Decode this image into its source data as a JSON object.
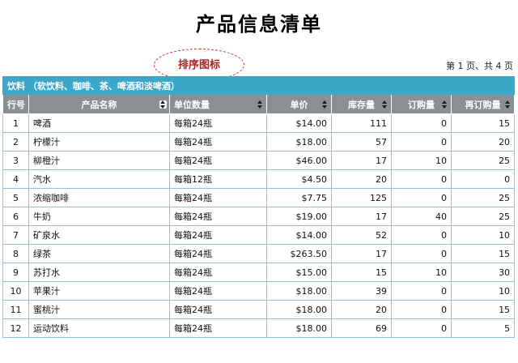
{
  "title": "产品信息清单",
  "callout_label": "排序图标",
  "page_info": "第 1 页、共 4 页",
  "group_header": "饮料  （软饮料、咖啡、茶、啤酒和淡啤酒）",
  "columns": [
    "行号",
    "产品名称",
    "单位数量",
    "单价",
    "库存量",
    "订购量",
    "再订购量"
  ],
  "rows": [
    {
      "no": "1",
      "name": "啤酒",
      "unit": "每箱24瓶",
      "price": "$14.00",
      "stock": "111",
      "ordered": "0",
      "reorder": "15"
    },
    {
      "no": "2",
      "name": "柠檬汁",
      "unit": "每箱24瓶",
      "price": "$18.00",
      "stock": "57",
      "ordered": "0",
      "reorder": "20"
    },
    {
      "no": "3",
      "name": "柳橙汁",
      "unit": "每箱24瓶",
      "price": "$46.00",
      "stock": "17",
      "ordered": "10",
      "reorder": "25"
    },
    {
      "no": "4",
      "name": "汽水",
      "unit": "每箱12瓶",
      "price": "$4.50",
      "stock": "20",
      "ordered": "0",
      "reorder": "0"
    },
    {
      "no": "5",
      "name": "浓缩咖啡",
      "unit": "每箱24瓶",
      "price": "$7.75",
      "stock": "125",
      "ordered": "0",
      "reorder": "25"
    },
    {
      "no": "6",
      "name": "牛奶",
      "unit": "每箱24瓶",
      "price": "$19.00",
      "stock": "17",
      "ordered": "40",
      "reorder": "25"
    },
    {
      "no": "7",
      "name": "矿泉水",
      "unit": "每箱24瓶",
      "price": "$14.00",
      "stock": "52",
      "ordered": "0",
      "reorder": "10"
    },
    {
      "no": "8",
      "name": "绿茶",
      "unit": "每箱24瓶",
      "price": "$263.50",
      "stock": "17",
      "ordered": "0",
      "reorder": "15"
    },
    {
      "no": "9",
      "name": "苏打水",
      "unit": "每箱24瓶",
      "price": "$15.00",
      "stock": "15",
      "ordered": "10",
      "reorder": "30"
    },
    {
      "no": "10",
      "name": "苹果汁",
      "unit": "每箱24瓶",
      "price": "$18.00",
      "stock": "39",
      "ordered": "0",
      "reorder": "10"
    },
    {
      "no": "11",
      "name": "蜜桃汁",
      "unit": "每箱24瓶",
      "price": "$18.00",
      "stock": "20",
      "ordered": "0",
      "reorder": "15"
    },
    {
      "no": "12",
      "name": "运动饮料",
      "unit": "每箱24瓶",
      "price": "$18.00",
      "stock": "69",
      "ordered": "0",
      "reorder": "5"
    }
  ],
  "colors": {
    "group_bg": "#3ba8c9",
    "header_bg": "#8a8f94",
    "grid_border": "#8fc3d3",
    "callout": "#b22222"
  }
}
